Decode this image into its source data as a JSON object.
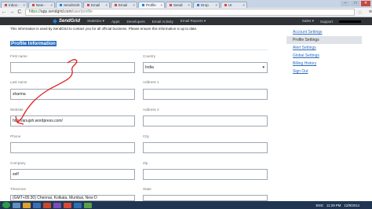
{
  "browser": {
    "tabs": [
      {
        "label": "Inbox -",
        "active": false
      },
      {
        "label": "New -",
        "active": false
      },
      {
        "label": "SendGrid",
        "active": false
      },
      {
        "label": "Email",
        "active": false
      },
      {
        "label": "Email",
        "active": false
      },
      {
        "label": "Profile",
        "active": true
      },
      {
        "label": "Sendi",
        "active": false
      },
      {
        "label": "Drop",
        "active": false
      },
      {
        "label": "UI",
        "active": false
      }
    ],
    "url_scheme": "https://",
    "url_host": "app.sendgrid.com",
    "url_path": "/user/profile",
    "window_controls": {
      "minimize": "–",
      "maximize": "□",
      "close": "✕"
    },
    "nav": {
      "back": "←",
      "forward": "→",
      "reload": "C"
    }
  },
  "app_nav": {
    "logo": "SendGrid",
    "items": [
      "Statistics ▾",
      "Apps",
      "Developers",
      "Email Activity",
      "Email Reports ▾"
    ],
    "right": [
      "Sales ▾",
      "Support"
    ]
  },
  "intro_text": "This information is used by SendGrid to contact you for all official business. Please ensure this information is up to date.",
  "section_title": "Profile Information",
  "form": {
    "first_name": {
      "label": "First name",
      "value": ""
    },
    "last_name": {
      "label": "Last name",
      "value": "sharma"
    },
    "website": {
      "label": "Website",
      "value": "http://anujsh.wordpress.com/"
    },
    "phone": {
      "label": "Phone",
      "value": "·   ·"
    },
    "company": {
      "label": "Company",
      "value": "self"
    },
    "timezone": {
      "label": "Timezone",
      "value": "(GMT+05:30) Chennai, Kolkata, Mumbai, New D"
    },
    "country": {
      "label": "Country",
      "value": "India"
    },
    "address1": {
      "label": "Address 1",
      "value": "·   ·   ·"
    },
    "address2": {
      "label": "Address 2",
      "value": ""
    },
    "city": {
      "label": "City",
      "value": "·   ·"
    },
    "zip": {
      "label": "Zip",
      "value": "·"
    },
    "state": {
      "label": "State",
      "value": "·   ·"
    }
  },
  "sidebar": {
    "items": [
      {
        "label": "Account Settings",
        "active": false
      },
      {
        "label": "Profile Settings",
        "active": true
      },
      {
        "label": "Alert Settings",
        "active": false
      },
      {
        "label": "Global Settings",
        "active": false
      },
      {
        "label": "Billing History",
        "active": false
      },
      {
        "label": "Sign Out",
        "active": false
      }
    ]
  },
  "taskbar": {
    "time": "11:29 PM",
    "date": "12/9/2014",
    "lang": "ENG"
  },
  "colors": {
    "accent": "#2a6ebf",
    "nav_bg": "#2f3338",
    "annotation": "#e02020"
  }
}
